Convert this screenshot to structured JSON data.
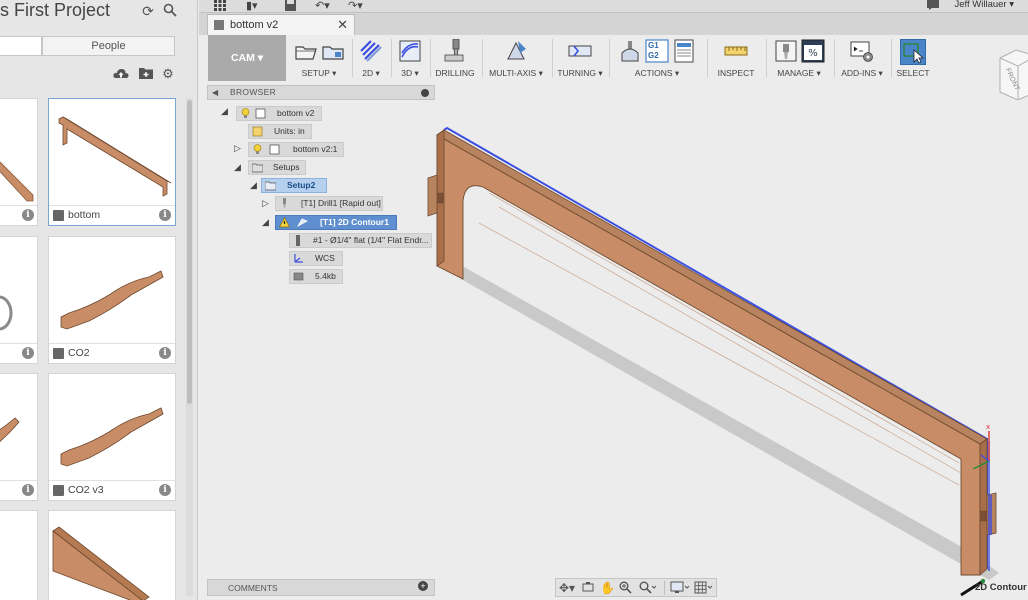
{
  "left_panel": {
    "project_title": "s First Project",
    "tabs": {
      "data": "",
      "people": "People"
    },
    "cards": [
      {
        "label": "",
        "has_info": true
      },
      {
        "label": "bottom",
        "has_info": true
      },
      {
        "label": "",
        "has_info": true
      },
      {
        "label": "CO2",
        "has_info": true
      },
      {
        "label": "",
        "has_info": true
      },
      {
        "label": "CO2 v3",
        "has_info": true
      }
    ]
  },
  "topbar": {
    "user": "Jeff Willauer ▾"
  },
  "document_tab": {
    "name": "bottom v2",
    "close": "✕"
  },
  "toolbar": {
    "workspace": "CAM ▾",
    "groups": [
      {
        "label": "SETUP ▾"
      },
      {
        "label": "2D ▾"
      },
      {
        "label": "3D ▾"
      },
      {
        "label": "DRILLING"
      },
      {
        "label": "MULTI-AXIS ▾"
      },
      {
        "label": "TURNING ▾"
      },
      {
        "label": "ACTIONS ▾"
      },
      {
        "label": "INSPECT"
      },
      {
        "label": "MANAGE ▾"
      },
      {
        "label": "ADD-INS ▾"
      },
      {
        "label": "SELECT"
      }
    ],
    "actions_g1": "G1",
    "actions_g2": "G2"
  },
  "viewcube": {
    "face": "FRONT"
  },
  "browser": {
    "title": "BROWSER",
    "nodes": {
      "root": "bottom v2",
      "units": "Units: in",
      "component": "bottom v2:1",
      "setups": "Setups",
      "setup2": "Setup2",
      "drill": "[T1] Drill1 [Rapid out]",
      "contour": "[T1] 2D Contour1",
      "tool": "#1 - Ø1/4\" flat (1/4\" Flat Endr...",
      "wcs": "WCS",
      "size": "5.4kb"
    }
  },
  "comments": {
    "title": "COMMENTS"
  },
  "status": {
    "operation": "2D Contour"
  },
  "colors": {
    "wood": "#c88d66",
    "wood_dark": "#8a5a3c",
    "toolpath": "#3b4fe0",
    "select_blue": "#4a84c9"
  }
}
